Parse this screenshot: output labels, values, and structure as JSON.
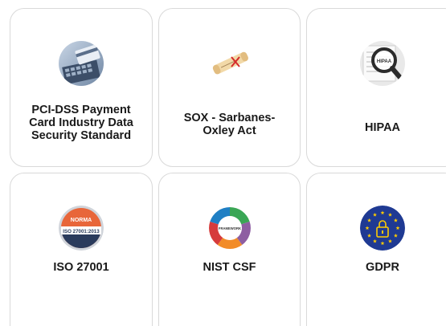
{
  "cards": [
    {
      "label": "PCI-DSS Payment\nCard Industry Data\nSecurity Standard",
      "icon": "credit-card-keyboard-icon"
    },
    {
      "label": "SOX - Sarbanes-\nOxley Act",
      "icon": "scroll-document-icon"
    },
    {
      "label": "HIPAA",
      "icon": "magnifier-document-icon"
    },
    {
      "label": "ISO 27001",
      "icon": "iso-badge-icon",
      "icon_text": {
        "top": "NORMA",
        "main": "ISO 27001:2013"
      }
    },
    {
      "label": "NIST CSF",
      "icon": "framework-wheel-icon",
      "icon_text": {
        "center": "FRAMEWORK"
      }
    },
    {
      "label": "GDPR",
      "icon": "eu-lock-icon"
    }
  ],
  "colors": {
    "card_border": "#d9d9d9",
    "label": "#1a1a1a",
    "eu_blue": "#1f3a93",
    "eu_star": "#ffcc00",
    "iso_orange": "#e8663a",
    "iso_navy": "#2a3b5c"
  }
}
